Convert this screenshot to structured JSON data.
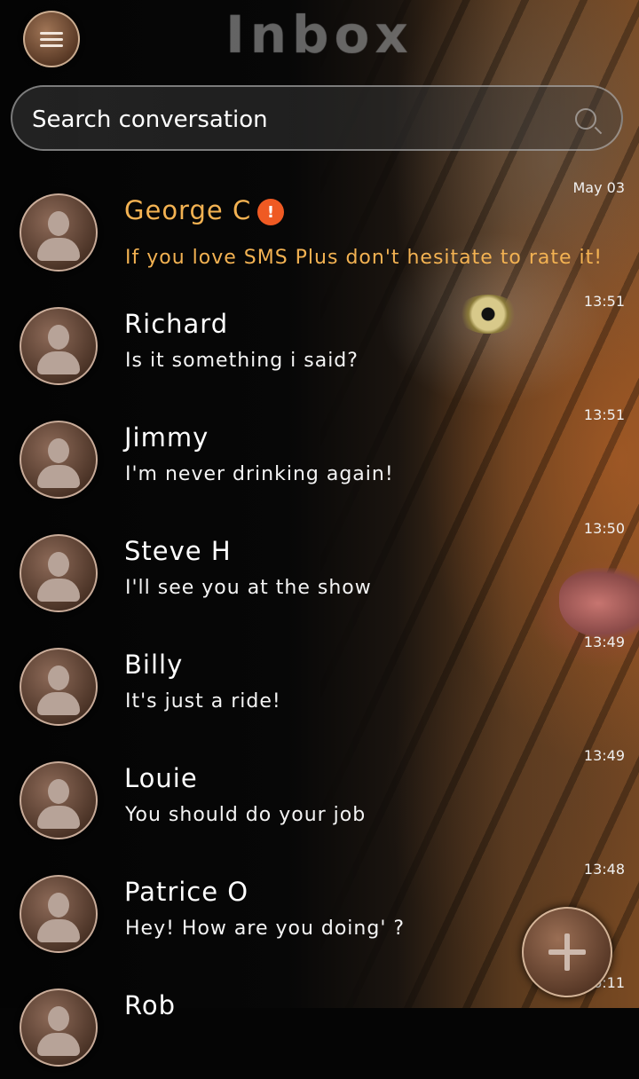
{
  "header": {
    "title": "Inbox"
  },
  "search": {
    "placeholder": "Search conversation"
  },
  "badge": {
    "text": "!"
  },
  "conversations": [
    {
      "name": "George C",
      "message": "If you love SMS Plus don't hesitate to rate it!",
      "time": "May 03",
      "unread": true
    },
    {
      "name": "Richard",
      "message": "Is it something i said?",
      "time": "13:51"
    },
    {
      "name": "Jimmy",
      "message": "I'm never drinking again!",
      "time": "13:51"
    },
    {
      "name": "Steve H",
      "message": "I'll see you at the show",
      "time": "13:50"
    },
    {
      "name": "Billy",
      "message": "It's just a ride!",
      "time": "13:49"
    },
    {
      "name": "Louie",
      "message": "You should do your job",
      "time": "13:49"
    },
    {
      "name": "Patrice O",
      "message": "Hey! How are you doing' ?",
      "time": "13:48"
    },
    {
      "name": "Rob",
      "message": "",
      "time": "16:11"
    }
  ],
  "colors": {
    "accent_unread": "#f3b252",
    "badge": "#ef5a23"
  }
}
